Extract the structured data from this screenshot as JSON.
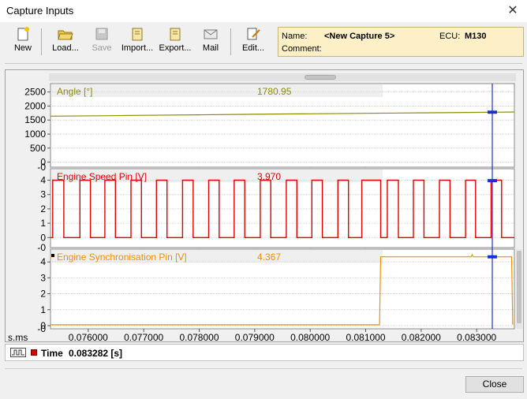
{
  "window": {
    "title": "Capture Inputs",
    "close_glyph": "✕"
  },
  "toolbar": {
    "buttons": [
      {
        "label": "New",
        "icon": "new-icon",
        "enabled": true
      },
      {
        "label": "Load...",
        "icon": "folder-open-icon",
        "enabled": true
      },
      {
        "label": "Save",
        "icon": "save-icon",
        "enabled": false
      },
      {
        "label": "Import...",
        "icon": "import-icon",
        "enabled": true
      },
      {
        "label": "Export...",
        "icon": "export-icon",
        "enabled": true
      },
      {
        "label": "Mail",
        "icon": "mail-icon",
        "enabled": true
      },
      {
        "label": "Edit...",
        "icon": "edit-icon",
        "enabled": true
      }
    ]
  },
  "info": {
    "name_label": "Name:",
    "name_value": "<New Capture 5>",
    "ecu_label": "ECU:",
    "ecu_value": "M130",
    "comment_label": "Comment:",
    "comment_value": ""
  },
  "chart_data": {
    "type": "line",
    "x_axis": {
      "label": "s.ms",
      "range": [
        0.07532,
        0.08368
      ],
      "ticks": [
        "0.076000",
        "0.077000",
        "0.078000",
        "0.079000",
        "0.080000",
        "0.081000",
        "0.082000",
        "0.083000"
      ],
      "tick_values": [
        0.076,
        0.077,
        0.078,
        0.079,
        0.08,
        0.081,
        0.082,
        0.083
      ]
    },
    "cursor_x": 0.083282,
    "panels": [
      {
        "name": "Angle [°]",
        "cursor_value": "1780.95",
        "color": "#8b8b00",
        "ylim": [
          -180,
          2800
        ],
        "ticks": [
          "2500",
          "2000",
          "1500",
          "1000",
          "500",
          "0"
        ],
        "tick_values": [
          2500,
          2000,
          1500,
          1000,
          500,
          0
        ],
        "series": {
          "x": [
            0.07532,
            0.0764,
            0.077,
            0.078,
            0.079,
            0.08,
            0.081,
            0.082,
            0.083,
            0.08368
          ],
          "y": [
            1640,
            1655,
            1670,
            1688,
            1705,
            1722,
            1740,
            1758,
            1775,
            1788
          ]
        }
      },
      {
        "name": "Engine Speed Pin [V]",
        "cursor_value": "3.970",
        "color": "#e00000",
        "ylim": [
          -0.7,
          4.8
        ],
        "ticks": [
          "4",
          "3",
          "2",
          "1",
          "0"
        ],
        "tick_values": [
          4,
          3,
          2,
          1,
          0
        ],
        "square_wave": {
          "high": 4.0,
          "low": 0.0,
          "segments": [
            [
              0.07532,
              0.07536,
              0
            ],
            [
              0.07536,
              0.07556,
              4
            ],
            [
              0.07556,
              0.07585,
              0
            ],
            [
              0.07585,
              0.07604,
              4
            ],
            [
              0.07604,
              0.0763,
              0
            ],
            [
              0.0763,
              0.07649,
              4
            ],
            [
              0.07649,
              0.07677,
              0
            ],
            [
              0.07677,
              0.07696,
              4
            ],
            [
              0.07696,
              0.07723,
              0
            ],
            [
              0.07723,
              0.07742,
              4
            ],
            [
              0.07742,
              0.0777,
              0
            ],
            [
              0.0777,
              0.07789,
              4
            ],
            [
              0.07789,
              0.07817,
              0
            ],
            [
              0.07817,
              0.07836,
              4
            ],
            [
              0.07836,
              0.07863,
              0
            ],
            [
              0.07863,
              0.07882,
              4
            ],
            [
              0.07882,
              0.0791,
              0
            ],
            [
              0.0791,
              0.07929,
              4
            ],
            [
              0.07929,
              0.07957,
              0
            ],
            [
              0.07957,
              0.07976,
              4
            ],
            [
              0.07976,
              0.08003,
              0
            ],
            [
              0.08003,
              0.08022,
              4
            ],
            [
              0.08022,
              0.0805,
              0
            ],
            [
              0.0805,
              0.08069,
              4
            ],
            [
              0.08069,
              0.08093,
              0
            ],
            [
              0.08093,
              0.08127,
              4
            ],
            [
              0.08127,
              0.08139,
              0
            ],
            [
              0.08139,
              0.08159,
              4
            ],
            [
              0.08159,
              0.08186,
              0
            ],
            [
              0.08186,
              0.08205,
              4
            ],
            [
              0.08205,
              0.08233,
              0
            ],
            [
              0.08233,
              0.08252,
              4
            ],
            [
              0.08252,
              0.0828,
              0
            ],
            [
              0.0828,
              0.08298,
              4
            ],
            [
              0.08298,
              0.08326,
              0
            ],
            [
              0.08326,
              0.08345,
              4
            ],
            [
              0.08345,
              0.08368,
              0
            ]
          ]
        }
      },
      {
        "name": "Engine Synchronisation Pin [V]",
        "cursor_value": "4.367",
        "color": "#f09000",
        "ylim": [
          -0.2,
          4.8
        ],
        "ticks": [
          "4",
          "3",
          "2",
          "1",
          "0"
        ],
        "tick_values": [
          4,
          3,
          2,
          1,
          0
        ],
        "series": {
          "x": [
            0.07532,
            0.0782,
            0.07822,
            0.08125,
            0.08127,
            0.0829,
            0.08292,
            0.08294,
            0.08363,
            0.08365
          ],
          "y": [
            0.05,
            0.05,
            0.05,
            0.05,
            4.32,
            4.32,
            4.45,
            4.32,
            4.32,
            0.05
          ]
        }
      }
    ]
  },
  "time": {
    "label": "Time",
    "value": "0.083282 [s]"
  },
  "buttons": {
    "close": "Close"
  }
}
